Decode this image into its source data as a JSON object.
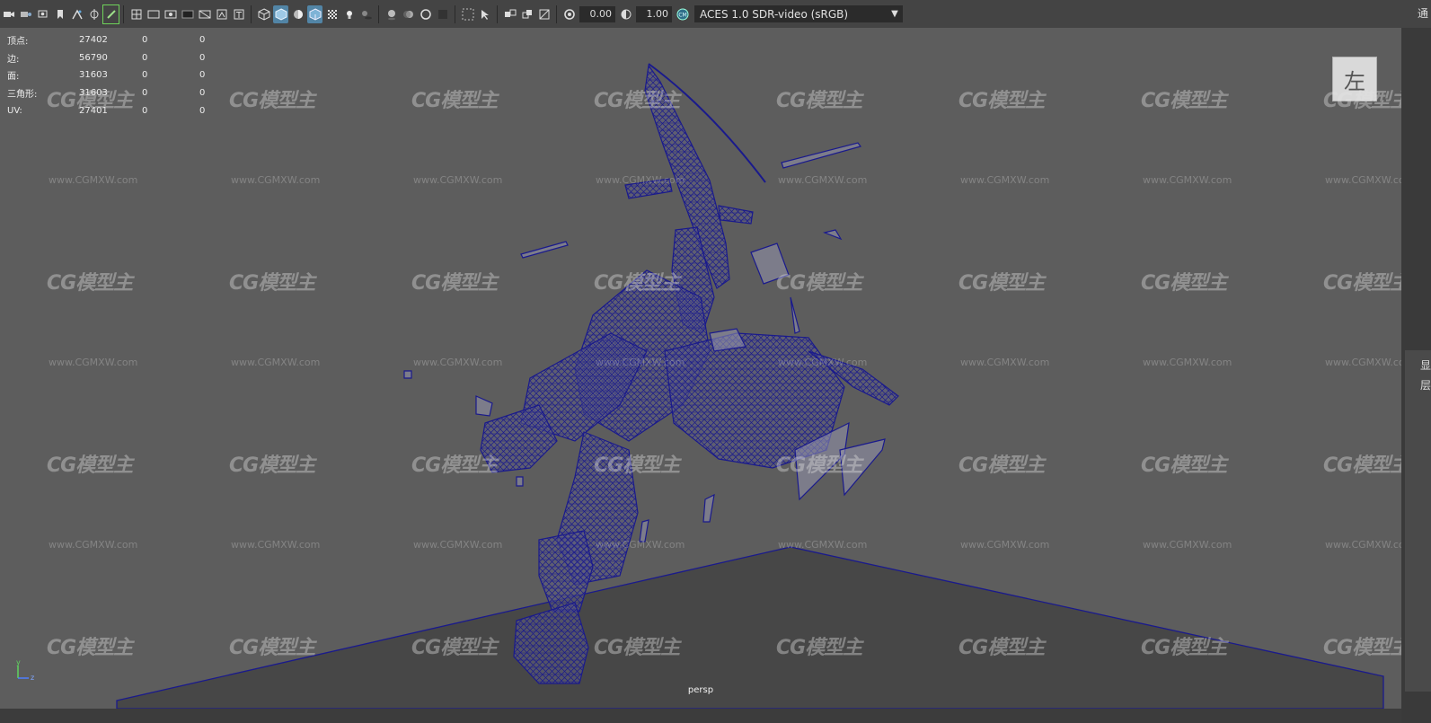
{
  "toolbar": {
    "icons": [
      "camera-icon",
      "camera-attr-icon",
      "bookmark-icon",
      "bookmark2-icon",
      "image-plane-icon",
      "pivot-icon",
      "snap-icon",
      "pencil-icon",
      "grid-icon",
      "film-gate-icon",
      "resolution-gate-icon",
      "gate-mask-icon",
      "field-chart-icon",
      "safe-action-icon",
      "safe-title-icon",
      "wireframe-icon",
      "smooth-shade-icon",
      "shade-default-icon",
      "wireframe-on-shaded-icon",
      "xray-icon",
      "lights-icon",
      "shadows-icon",
      "ambient-occlusion-icon",
      "motion-blur-icon",
      "anti-alias-icon",
      "depth-of-field-icon",
      "isolate-icon",
      "select-camera-icon",
      "xray-joints-icon",
      "xray-active-icon",
      "backface-icon",
      "exposure-icon",
      "gamma-icon",
      "color-management-icon"
    ],
    "exposure_value": "0.00",
    "gamma_value": "1.00",
    "color_space": "ACES 1.0 SDR-video (sRGB)"
  },
  "hud": {
    "rows": [
      {
        "label": "顶点:",
        "value": "27402",
        "c1": "0",
        "c2": "0"
      },
      {
        "label": "边:",
        "value": "56790",
        "c1": "0",
        "c2": "0"
      },
      {
        "label": "面:",
        "value": "31603",
        "c1": "0",
        "c2": "0"
      },
      {
        "label": "三角形:",
        "value": "31603",
        "c1": "0",
        "c2": "0"
      },
      {
        "label": "UV:",
        "value": "27401",
        "c1": "0",
        "c2": "0"
      }
    ]
  },
  "viewcube": {
    "label": "左"
  },
  "camera": {
    "name": "persp"
  },
  "axis": {
    "y": "y",
    "z": "z"
  },
  "watermark": {
    "logo": "CG模型主",
    "url": "www.CGMXW.com"
  },
  "right_panel": {
    "top": "通",
    "item_a": "显",
    "item_b": "层"
  },
  "colors": {
    "wire": "#1a1a8c",
    "viewport_bg": "#5d5d5d",
    "ground": "#474747",
    "toolbar_bg": "#444444",
    "active_icon": "#5285a6"
  }
}
